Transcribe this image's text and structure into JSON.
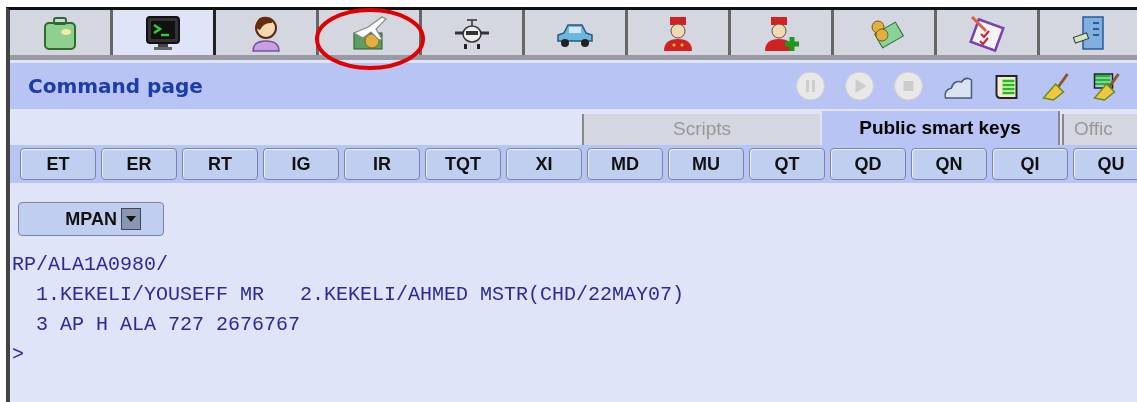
{
  "app_tabs": [
    {
      "kind": "suitcase",
      "selected": false,
      "circled": false
    },
    {
      "kind": "terminal",
      "selected": true,
      "circled": false
    },
    {
      "kind": "agent",
      "selected": false,
      "circled": false
    },
    {
      "kind": "plane-money",
      "selected": false,
      "circled": true
    },
    {
      "kind": "plane-front",
      "selected": false,
      "circled": false
    },
    {
      "kind": "car",
      "selected": false,
      "circled": false
    },
    {
      "kind": "bellboy",
      "selected": false,
      "circled": false
    },
    {
      "kind": "bellboy-add",
      "selected": false,
      "circled": false
    },
    {
      "kind": "money",
      "selected": false,
      "circled": false
    },
    {
      "kind": "checklist",
      "selected": false,
      "circled": false
    },
    {
      "kind": "server",
      "selected": false,
      "circled": false
    }
  ],
  "panel": {
    "title": "Command page",
    "tools": [
      {
        "kind": "pause",
        "disabled": true
      },
      {
        "kind": "play",
        "disabled": true
      },
      {
        "kind": "stop",
        "disabled": true
      },
      {
        "kind": "cloud",
        "disabled": false
      },
      {
        "kind": "scroll",
        "disabled": false
      },
      {
        "kind": "broom",
        "disabled": false
      },
      {
        "kind": "broom-list",
        "disabled": false
      }
    ]
  },
  "key_tabs": [
    {
      "label": "Scripts",
      "selected": false
    },
    {
      "label": "Public smart keys",
      "selected": true
    },
    {
      "label": "Offic",
      "selected": false
    }
  ],
  "smart_keys": [
    "ET",
    "ER",
    "RT",
    "IG",
    "IR",
    "TQT",
    "XI",
    "MD",
    "MU",
    "QT",
    "QD",
    "QN",
    "QI",
    "QU"
  ],
  "dropdown": {
    "value": "MPAN"
  },
  "terminal_lines": [
    "RP/ALA1A0980/",
    "  1.KEKELI/YOUSEFF MR   2.KEKELI/AHMED MSTR(CHD/22MAY07)",
    "  3 AP H ALA 727 2676767",
    ">"
  ]
}
